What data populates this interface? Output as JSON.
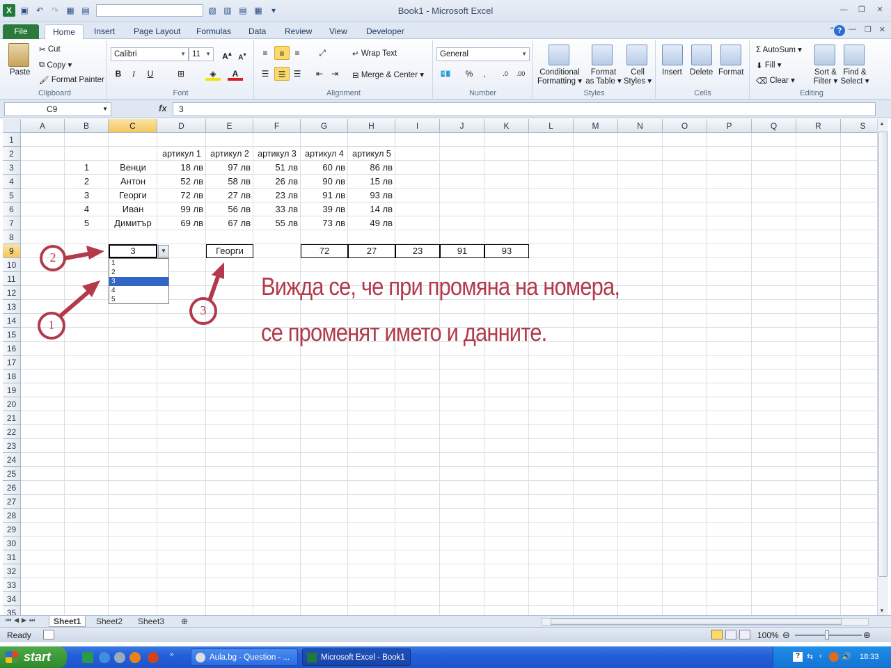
{
  "window": {
    "title": "Book1 - Microsoft Excel"
  },
  "ribbon_tabs": [
    "File",
    "Home",
    "Insert",
    "Page Layout",
    "Formulas",
    "Data",
    "Review",
    "View",
    "Developer"
  ],
  "ribbon": {
    "clipboard": {
      "paste": "Paste",
      "cut": "Cut",
      "copy": "Copy",
      "format_painter": "Format Painter",
      "group": "Clipboard"
    },
    "font": {
      "name": "Calibri",
      "size": "11",
      "bold": "B",
      "italic": "I",
      "underline": "U",
      "group": "Font"
    },
    "alignment": {
      "wrap_text": "Wrap Text",
      "merge_center": "Merge & Center",
      "group": "Alignment"
    },
    "number": {
      "format": "General",
      "percent": "%",
      "comma": ",",
      "group": "Number"
    },
    "styles": {
      "conditional": "Conditional",
      "conditional2": "Formatting",
      "format_table": "Format",
      "format_table2": "as Table",
      "cell_styles": "Cell",
      "cell_styles2": "Styles",
      "group": "Styles"
    },
    "cells": {
      "insert": "Insert",
      "delete": "Delete",
      "format": "Format",
      "group": "Cells"
    },
    "editing": {
      "autosum": "AutoSum",
      "fill": "Fill",
      "clear": "Clear",
      "sort": "Sort &",
      "sort2": "Filter",
      "find": "Find &",
      "find2": "Select",
      "group": "Editing"
    }
  },
  "formula_bar": {
    "name_box": "C9",
    "fx": "fx",
    "value": "3"
  },
  "columns": [
    "A",
    "B",
    "C",
    "D",
    "E",
    "F",
    "G",
    "H",
    "I",
    "J",
    "K",
    "L",
    "M",
    "N",
    "O",
    "P",
    "Q",
    "R",
    "S"
  ],
  "rows": [
    "1",
    "2",
    "3",
    "4",
    "5",
    "6",
    "7",
    "8",
    "9",
    "10",
    "11",
    "12",
    "13",
    "14",
    "15",
    "16",
    "17",
    "18",
    "19",
    "20",
    "21",
    "22",
    "23",
    "24",
    "25",
    "26",
    "27",
    "28",
    "29",
    "30",
    "31",
    "32",
    "33",
    "34",
    "35"
  ],
  "table": {
    "headers": [
      "артикул 1",
      "артикул 2",
      "артикул 3",
      "артикул 4",
      "артикул 5"
    ],
    "rows": [
      {
        "num": "1",
        "name": "Венци",
        "vals": [
          "18 лв",
          "97 лв",
          "51 лв",
          "60 лв",
          "86 лв"
        ]
      },
      {
        "num": "2",
        "name": "Антон",
        "vals": [
          "52 лв",
          "58 лв",
          "26 лв",
          "90 лв",
          "15 лв"
        ]
      },
      {
        "num": "3",
        "name": "Георги",
        "vals": [
          "72 лв",
          "27 лв",
          "23 лв",
          "91 лв",
          "93 лв"
        ]
      },
      {
        "num": "4",
        "name": "Иван",
        "vals": [
          "99 лв",
          "56 лв",
          "33 лв",
          "39 лв",
          "14 лв"
        ]
      },
      {
        "num": "5",
        "name": "Димитър",
        "vals": [
          "69 лв",
          "67 лв",
          "55 лв",
          "73 лв",
          "49 лв"
        ]
      }
    ]
  },
  "lookup": {
    "selected": "3",
    "name": "Георги",
    "vals": [
      "72",
      "27",
      "23",
      "91",
      "93"
    ]
  },
  "dropdown_options": [
    "1",
    "2",
    "3",
    "4",
    "5"
  ],
  "annotations": {
    "line1": "Вижда се, че при промяна на номера,",
    "line2": "се променят името и данните.",
    "n1": "1",
    "n2": "2",
    "n3": "3"
  },
  "sheets": [
    "Sheet1",
    "Sheet2",
    "Sheet3"
  ],
  "status": {
    "ready": "Ready",
    "zoom": "100%"
  },
  "taskbar": {
    "start": "start",
    "item1": "Aula.bg - Question - ...",
    "item2": "Microsoft Excel - Book1",
    "lang": "EN",
    "clock": "18:33"
  }
}
